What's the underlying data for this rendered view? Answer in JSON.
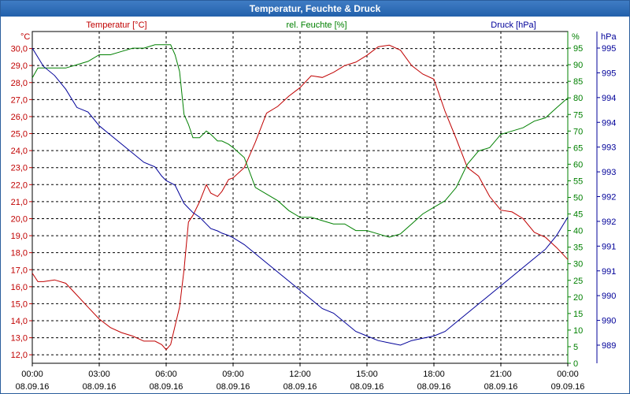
{
  "title": "Temperatur, Feuchte & Druck",
  "colors": {
    "temperature": "#c00000",
    "humidity": "#008000",
    "pressure": "#000099",
    "titlebar": "#2a67b3"
  },
  "chart_data": {
    "type": "line",
    "title": "Temperatur, Feuchte & Druck",
    "grid": true,
    "x_axis": {
      "range": [
        0,
        24
      ],
      "tick_times": [
        "00:00",
        "03:00",
        "06:00",
        "09:00",
        "12:00",
        "15:00",
        "18:00",
        "21:00",
        "00:00"
      ],
      "tick_dates": [
        "08.09.16",
        "08.09.16",
        "08.09.16",
        "08.09.16",
        "08.09.16",
        "08.09.16",
        "08.09.16",
        "08.09.16",
        "09.09.16"
      ]
    },
    "axes": {
      "temperature": {
        "label": "Temperatur [°C]",
        "unit": "°C",
        "range": [
          11.5,
          31.0
        ],
        "ticks": [
          "12,0",
          "13,0",
          "14,0",
          "15,0",
          "16,0",
          "17,0",
          "18,0",
          "19,0",
          "20,0",
          "21,0",
          "22,0",
          "23,0",
          "24,0",
          "25,0",
          "26,0",
          "27,0",
          "28,0",
          "29,0",
          "30,0"
        ],
        "tick_values": [
          12,
          13,
          14,
          15,
          16,
          17,
          18,
          19,
          20,
          21,
          22,
          23,
          24,
          25,
          26,
          27,
          28,
          29,
          30
        ]
      },
      "humidity": {
        "label": "rel. Feuchte [%]",
        "unit": "%",
        "range": [
          0,
          100
        ],
        "ticks": [
          "0",
          "5",
          "10",
          "15",
          "20",
          "25",
          "30",
          "35",
          "40",
          "45",
          "50",
          "55",
          "60",
          "65",
          "70",
          "75",
          "80",
          "85",
          "90",
          "95"
        ],
        "tick_values": [
          0,
          5,
          10,
          15,
          20,
          25,
          30,
          35,
          40,
          45,
          50,
          55,
          60,
          65,
          70,
          75,
          80,
          85,
          90,
          95
        ]
      },
      "pressure": {
        "label": "Druck [hPa]",
        "unit": "hPa",
        "ticks": [
          "989",
          "990",
          "990",
          "991",
          "991",
          "992",
          "992",
          "993",
          "993",
          "994",
          "994",
          "995",
          "995"
        ]
      }
    },
    "series": [
      {
        "name": "Temperatur [°C]",
        "axis": "temperature",
        "x": [
          0,
          0.25,
          0.5,
          1,
          1.5,
          2,
          2.5,
          3,
          3.5,
          4,
          4.5,
          5,
          5.5,
          5.8,
          6,
          6.2,
          6.4,
          6.6,
          6.8,
          7,
          7.2,
          7.5,
          7.8,
          8,
          8.3,
          8.5,
          8.8,
          9,
          9.5,
          10,
          10.5,
          11,
          11.5,
          12,
          12.5,
          13,
          13.5,
          14,
          14.5,
          15,
          15.5,
          16,
          16.5,
          17,
          17.5,
          18,
          18.5,
          19,
          19.5,
          20,
          20.5,
          21,
          21.5,
          22,
          22.5,
          23,
          23.5,
          24
        ],
        "values": [
          16.8,
          16.3,
          16.3,
          16.4,
          16.2,
          15.5,
          14.8,
          14.1,
          13.6,
          13.3,
          13.1,
          12.8,
          12.8,
          12.6,
          12.3,
          12.6,
          13.7,
          14.8,
          17.0,
          19.8,
          20.2,
          21.0,
          22.0,
          21.5,
          21.3,
          21.6,
          22.3,
          22.4,
          23.0,
          24.5,
          26.2,
          26.6,
          27.2,
          27.7,
          28.4,
          28.3,
          28.6,
          29.0,
          29.2,
          29.6,
          30.1,
          30.2,
          29.9,
          29.0,
          28.5,
          28.2,
          26.3,
          24.7,
          23.0,
          22.5,
          21.3,
          20.5,
          20.4,
          20.0,
          19.2,
          18.9,
          18.3,
          17.6
        ]
      },
      {
        "name": "rel. Feuchte [%]",
        "axis": "humidity",
        "x": [
          0,
          0.25,
          0.5,
          1,
          1.5,
          2,
          2.5,
          3,
          3.5,
          4,
          4.5,
          5,
          5.5,
          5.8,
          6,
          6.2,
          6.4,
          6.6,
          6.8,
          7,
          7.2,
          7.5,
          7.8,
          8,
          8.3,
          8.5,
          8.8,
          9,
          9.5,
          10,
          10.5,
          11,
          11.5,
          12,
          12.5,
          13,
          13.5,
          14,
          14.5,
          15,
          15.5,
          16,
          16.5,
          17,
          17.5,
          18,
          18.5,
          19,
          19.5,
          20,
          20.5,
          21,
          21.5,
          22,
          22.5,
          23,
          23.5,
          24
        ],
        "values": [
          86,
          89,
          89,
          89,
          89,
          90,
          91,
          93,
          93,
          94,
          95,
          95,
          96,
          96,
          96,
          96,
          93,
          88,
          75,
          72,
          68,
          68,
          70,
          69,
          67,
          67,
          66,
          65,
          62,
          53,
          51,
          49,
          46,
          44,
          44,
          43,
          42,
          42,
          40,
          40,
          39,
          38,
          39,
          42,
          45,
          47,
          49,
          53,
          60,
          64,
          65,
          69,
          70,
          71,
          73,
          74,
          77,
          80
        ]
      },
      {
        "name": "Druck [hPa]",
        "axis": "pressure",
        "x": [
          0,
          0.25,
          0.5,
          1,
          1.5,
          2,
          2.5,
          3,
          3.5,
          4,
          4.5,
          5,
          5.5,
          5.8,
          6,
          6.2,
          6.4,
          6.6,
          6.8,
          7,
          7.2,
          7.5,
          7.8,
          8,
          8.3,
          8.5,
          8.8,
          9,
          9.5,
          10,
          10.5,
          11,
          11.5,
          12,
          12.5,
          13,
          13.5,
          14,
          14.5,
          15,
          15.5,
          16,
          16.5,
          17,
          17.5,
          18,
          18.5,
          19,
          19.5,
          20,
          20.5,
          21,
          21.5,
          22,
          22.5,
          23,
          23.5,
          24
        ],
        "values": [
          995.3,
          995.1,
          994.9,
          994.7,
          994.4,
          994.0,
          993.9,
          993.6,
          993.4,
          993.2,
          993.0,
          992.8,
          992.7,
          992.5,
          992.4,
          992.35,
          992.3,
          992.1,
          991.9,
          991.8,
          991.7,
          991.6,
          991.45,
          991.35,
          991.3,
          991.25,
          991.2,
          991.15,
          991.0,
          990.8,
          990.6,
          990.4,
          990.2,
          990.0,
          989.8,
          989.6,
          989.5,
          989.3,
          989.1,
          989.0,
          988.9,
          988.85,
          988.8,
          988.9,
          988.95,
          989.0,
          989.1,
          989.3,
          989.5,
          989.7,
          989.9,
          990.1,
          990.3,
          990.5,
          990.7,
          990.9,
          991.2,
          991.6
        ]
      }
    ]
  }
}
